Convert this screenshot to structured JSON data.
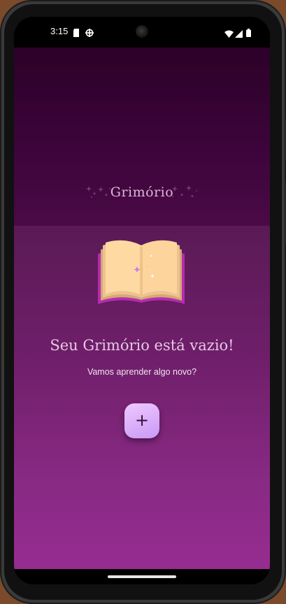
{
  "status_bar": {
    "time": "3:15",
    "left_icons": [
      "sd-card-icon",
      "settings-cog-icon"
    ],
    "right_icons": [
      "wifi-icon",
      "signal-icon",
      "battery-icon"
    ]
  },
  "app_bar": {
    "title": "Grimório"
  },
  "empty_state": {
    "title": "Seu Grimório está vazio!",
    "subtitle": "Vamos aprender algo novo?",
    "illustration": "open-book-icon"
  },
  "fab": {
    "label": "+",
    "icon": "plus-icon",
    "color": "#d9aef8"
  },
  "colors": {
    "app_bar_background": "#3c043a",
    "content_top": "#5a1a55",
    "content_bottom": "#962c90",
    "title_text": "#d9b8d8"
  }
}
